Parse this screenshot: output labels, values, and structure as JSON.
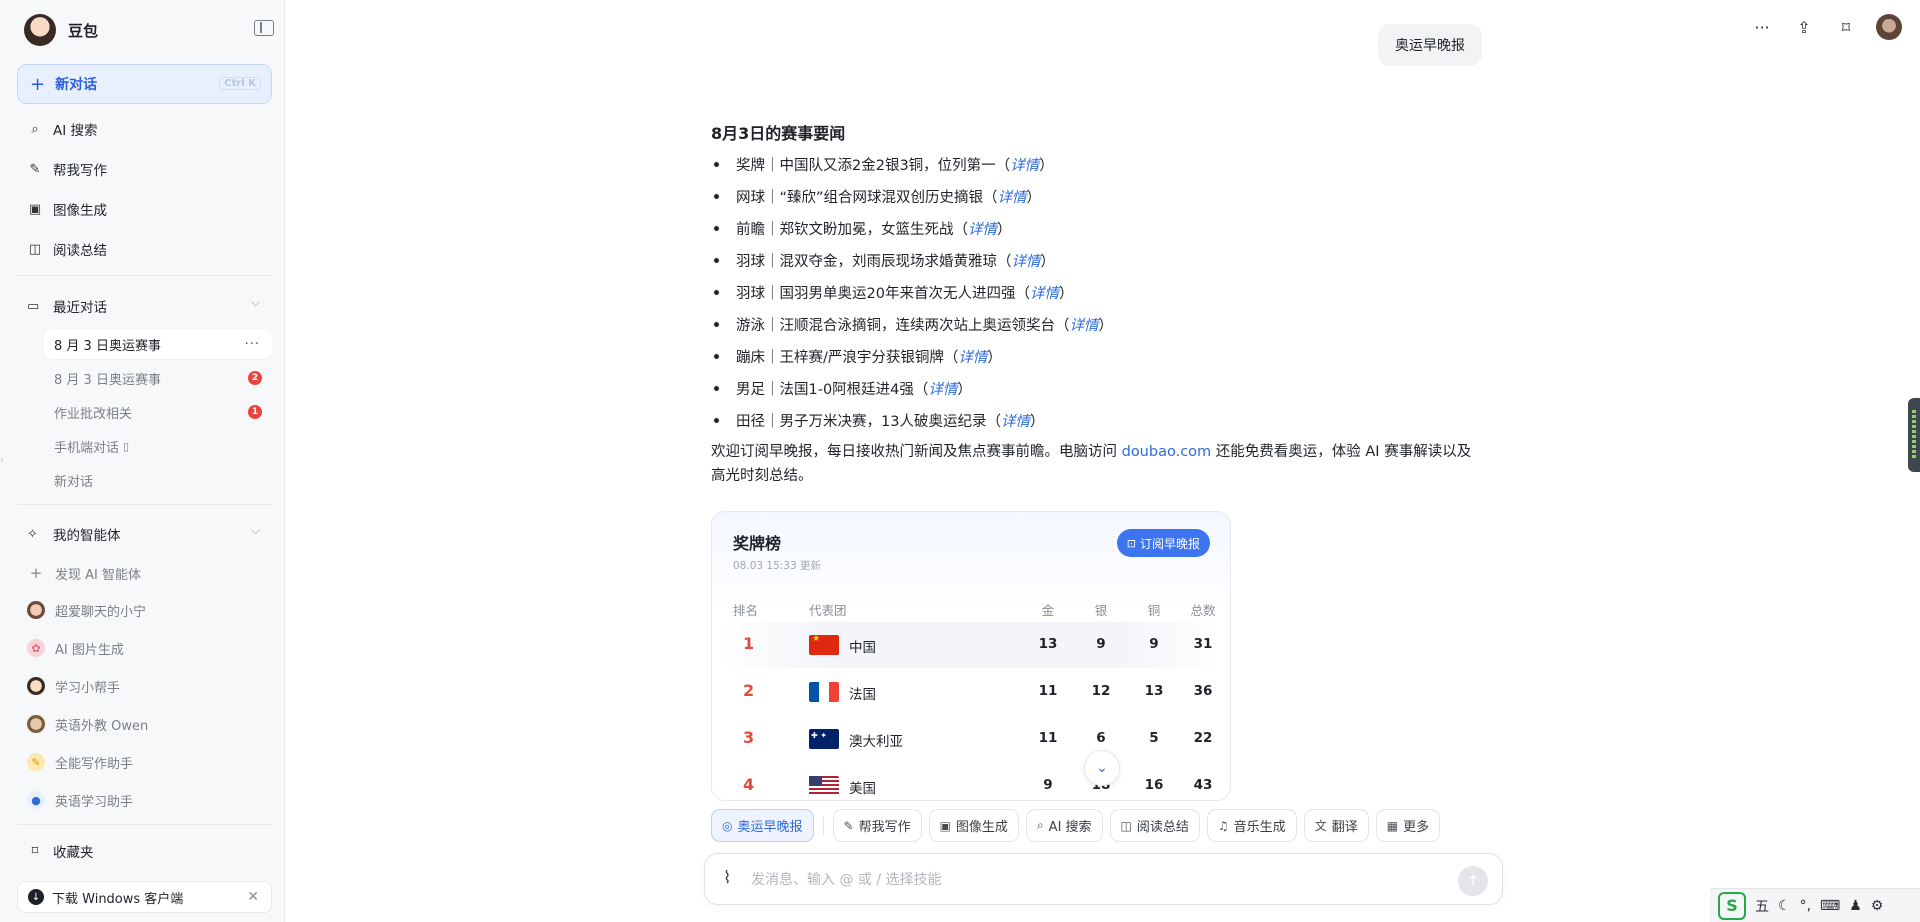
{
  "app": {
    "brand": "豆包",
    "new_chat": "新对话",
    "new_chat_shortcut": "Ctrl K"
  },
  "sidebar": {
    "menu": [
      {
        "label": "AI 搜索",
        "icon": "search-icon"
      },
      {
        "label": "帮我写作",
        "icon": "pen-icon"
      },
      {
        "label": "图像生成",
        "icon": "image-icon"
      },
      {
        "label": "阅读总结",
        "icon": "book-icon"
      }
    ],
    "recent_title": "最近对话",
    "conversations": [
      {
        "label": "8 月 3 日奥运赛事",
        "active": true
      },
      {
        "label": "8 月 3 日奥运赛事",
        "badge": "2"
      },
      {
        "label": "作业批改相关",
        "badge": "1"
      },
      {
        "label": "手机端对话"
      },
      {
        "label": "新对话"
      }
    ],
    "agents_title": "我的智能体",
    "agents": [
      {
        "label": "发现 AI 智能体",
        "icon": "plus-icon"
      },
      {
        "label": "超爱聊天的小宁",
        "icon": "avatar"
      },
      {
        "label": "AI 图片生成",
        "icon": "avatar"
      },
      {
        "label": "学习小帮手",
        "icon": "avatar"
      },
      {
        "label": "英语外教 Owen",
        "icon": "avatar"
      },
      {
        "label": "全能写作助手",
        "icon": "avatar"
      },
      {
        "label": "英语学习助手",
        "icon": "avatar"
      }
    ],
    "favorites": "收藏夹",
    "download": "下载 Windows 客户端"
  },
  "chat": {
    "user_message": "奥运早晚报",
    "heading": "8月3日的赛事要闻",
    "link_text": "详情",
    "bullets": [
      "奖牌｜中国队又添2金2银3铜，位列第一（",
      "网球｜“臻欣”组合网球混双创历史摘银（",
      "前瞻｜郑钦文盼加冕，女篮生死战（",
      "羽球｜混双夺金，刘雨辰现场求婚黄雅琼（",
      "羽球｜国羽男单奥运20年来首次无人进四强（",
      "游泳｜汪顺混合泳摘铜，连续两次站上奥运领奖台（",
      "蹦床｜王梓赛/严浪宇分获银铜牌（",
      "男足｜法国1-0阿根廷进4强（",
      "田径｜男子万米决赛，13人破奥运纪录（"
    ],
    "bullet_close": "）",
    "intro_before": "欢迎订阅早晚报，每日接收热门新闻及焦点赛事前瞻。电脑访问 ",
    "intro_site": "doubao.com",
    "intro_after": " 还能免费看奥运，体验 AI 赛事解读以及高光时刻总结。"
  },
  "medal_card": {
    "title": "奖牌榜",
    "updated": "08.03 15:33 更新",
    "subscribe": "订阅早晚报",
    "headers": {
      "rank": "排名",
      "team": "代表团",
      "gold": "金",
      "silver": "银",
      "bronze": "铜",
      "total": "总数"
    },
    "rows": [
      {
        "rank": "1",
        "team": "中国",
        "flag": "flag-cn",
        "gold": "13",
        "silver": "9",
        "bronze": "9",
        "total": "31"
      },
      {
        "rank": "2",
        "team": "法国",
        "flag": "flag-fr",
        "gold": "11",
        "silver": "12",
        "bronze": "13",
        "total": "36"
      },
      {
        "rank": "3",
        "team": "澳大利亚",
        "flag": "flag-au",
        "gold": "11",
        "silver": "6",
        "bronze": "5",
        "total": "22"
      },
      {
        "rank": "4",
        "team": "美国",
        "flag": "flag-us",
        "gold": "9",
        "silver": "18",
        "bronze": "16",
        "total": "43"
      }
    ]
  },
  "skills": [
    {
      "label": "奥运早晚报",
      "icon": "medal-icon",
      "active": true
    },
    {
      "label": "帮我写作",
      "icon": "pen-icon"
    },
    {
      "label": "图像生成",
      "icon": "image-icon"
    },
    {
      "label": "AI 搜索",
      "icon": "search-icon"
    },
    {
      "label": "阅读总结",
      "icon": "book-icon"
    },
    {
      "label": "音乐生成",
      "icon": "music-icon"
    },
    {
      "label": "翻译",
      "icon": "translate-icon"
    },
    {
      "label": "更多",
      "icon": "grid-icon"
    }
  ],
  "composer": {
    "placeholder": "发消息、输入 @ 或 / 选择技能"
  },
  "ime": {
    "logo": "S",
    "mode": "五"
  },
  "colors": {
    "accent": "#2e6bd9",
    "rank_red": "#e24b3b",
    "sidebar_bg": "#f7f8fa"
  }
}
